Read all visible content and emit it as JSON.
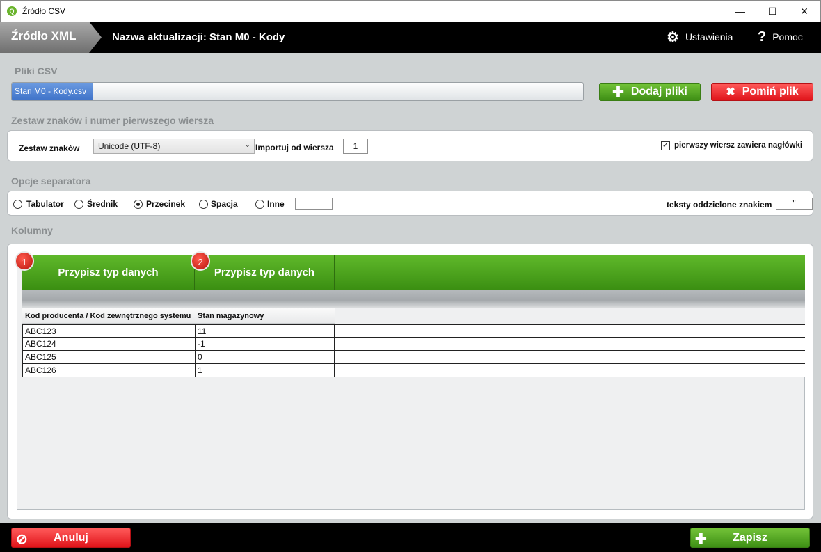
{
  "window": {
    "title": "Źródło CSV",
    "app_icon_letter": "Q",
    "minimize": "—",
    "maximize": "☐",
    "close": "✕"
  },
  "header": {
    "source_tab": "Źródło XML",
    "update_title": "Nazwa aktualizacji: Stan M0 - Kody",
    "settings": "Ustawienia",
    "help": "Pomoc"
  },
  "files": {
    "section": "Pliki CSV",
    "selected_file": "Stan M0 - Kody.csv",
    "add_button": "Dodaj pliki",
    "skip_button": "Pomiń plik"
  },
  "charset": {
    "section": "Zestaw znaków i numer pierwszego wiersza",
    "charset_label": "Zestaw znaków",
    "charset_value": "Unicode (UTF-8)",
    "import_label": "Importuj od wiersza",
    "import_value": "1",
    "header_checkbox": "pierwszy wiersz zawiera nagłówki",
    "header_checked": true
  },
  "separator": {
    "section": "Opcje separatora",
    "options": [
      "Tabulator",
      "Średnik",
      "Przecinek",
      "Spacja",
      "Inne"
    ],
    "selected": "Przecinek",
    "other_value": "",
    "text_qualifier_label": "teksty oddzielone znakiem",
    "text_qualifier_value": "\""
  },
  "columns": {
    "section": "Kolumny",
    "assign": [
      {
        "badge": "1",
        "label": "Przypisz typ danych"
      },
      {
        "badge": "2",
        "label": "Przypisz typ danych"
      }
    ],
    "headers": [
      "Kod producenta / Kod zewnętrznego systemu",
      "Stan magazynowy"
    ],
    "rows": [
      [
        "ABC123",
        "11"
      ],
      [
        "ABC124",
        "-1"
      ],
      [
        "ABC125",
        "0"
      ],
      [
        "ABC126",
        "1"
      ]
    ]
  },
  "footer": {
    "cancel": "Anuluj",
    "save": "Zapisz"
  },
  "colors": {
    "green": "#3e8f15",
    "red": "#e0141a",
    "header_bg": "#000000",
    "window_bg": "#cfd3d4",
    "file_chip": "#3f73c9"
  }
}
